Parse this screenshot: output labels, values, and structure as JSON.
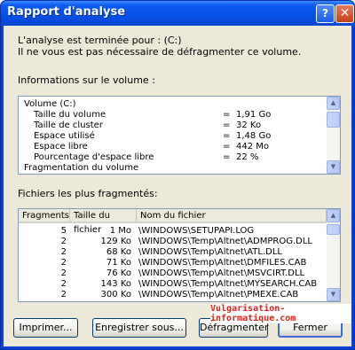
{
  "window": {
    "title": "Rapport d'analyse",
    "help_glyph": "?",
    "close_glyph": "✕"
  },
  "intro": {
    "line1": "L'analyse est terminée pour : (C:)",
    "line2": "Il ne vous est pas nécessaire de défragmenter ce volume."
  },
  "volume_section": {
    "label": "Informations sur le volume :",
    "header": "Volume  (C:)",
    "rows": [
      {
        "name": "Taille du volume",
        "eq": "=",
        "value": "1,91 Go"
      },
      {
        "name": "Taille de cluster",
        "eq": "=",
        "value": "32 Ko"
      },
      {
        "name": "Espace utilisé",
        "eq": "=",
        "value": "1,48 Go"
      },
      {
        "name": "Espace libre",
        "eq": "=",
        "value": "442 Mo"
      },
      {
        "name": "Pourcentage d'espace libre",
        "eq": "=",
        "value": "22 %"
      }
    ],
    "footer": "Fragmentation du volume"
  },
  "files_section": {
    "label": "Fichiers les plus fragmentés:",
    "columns": [
      "Fragments",
      "Taille du fichier",
      "Nom du fichier"
    ],
    "rows": [
      {
        "fragments": "5",
        "size": "1 Mo",
        "name": "\\WINDOWS\\SETUPAPI.LOG"
      },
      {
        "fragments": "2",
        "size": "129 Ko",
        "name": "\\WINDOWS\\Temp\\Altnet\\ADMPROG.DLL"
      },
      {
        "fragments": "2",
        "size": "68 Ko",
        "name": "\\WINDOWS\\Temp\\Altnet\\ATL.DLL"
      },
      {
        "fragments": "2",
        "size": "71 Ko",
        "name": "\\WINDOWS\\Temp\\Altnet\\DMFILES.CAB"
      },
      {
        "fragments": "2",
        "size": "76 Ko",
        "name": "\\WINDOWS\\Temp\\Altnet\\MSVCIRT.DLL"
      },
      {
        "fragments": "2",
        "size": "143 Ko",
        "name": "\\WINDOWS\\Temp\\Altnet\\MYSEARCH.CAB"
      },
      {
        "fragments": "2",
        "size": "300 Ko",
        "name": "\\WINDOWS\\Temp\\Altnet\\PMEXE.CAB"
      }
    ]
  },
  "watermark": "Vulgarisation-informatique.com",
  "buttons": {
    "print": "Imprimer...",
    "save": "Enregistrer sous...",
    "defrag": "Défragmenter",
    "close": "Fermer"
  }
}
